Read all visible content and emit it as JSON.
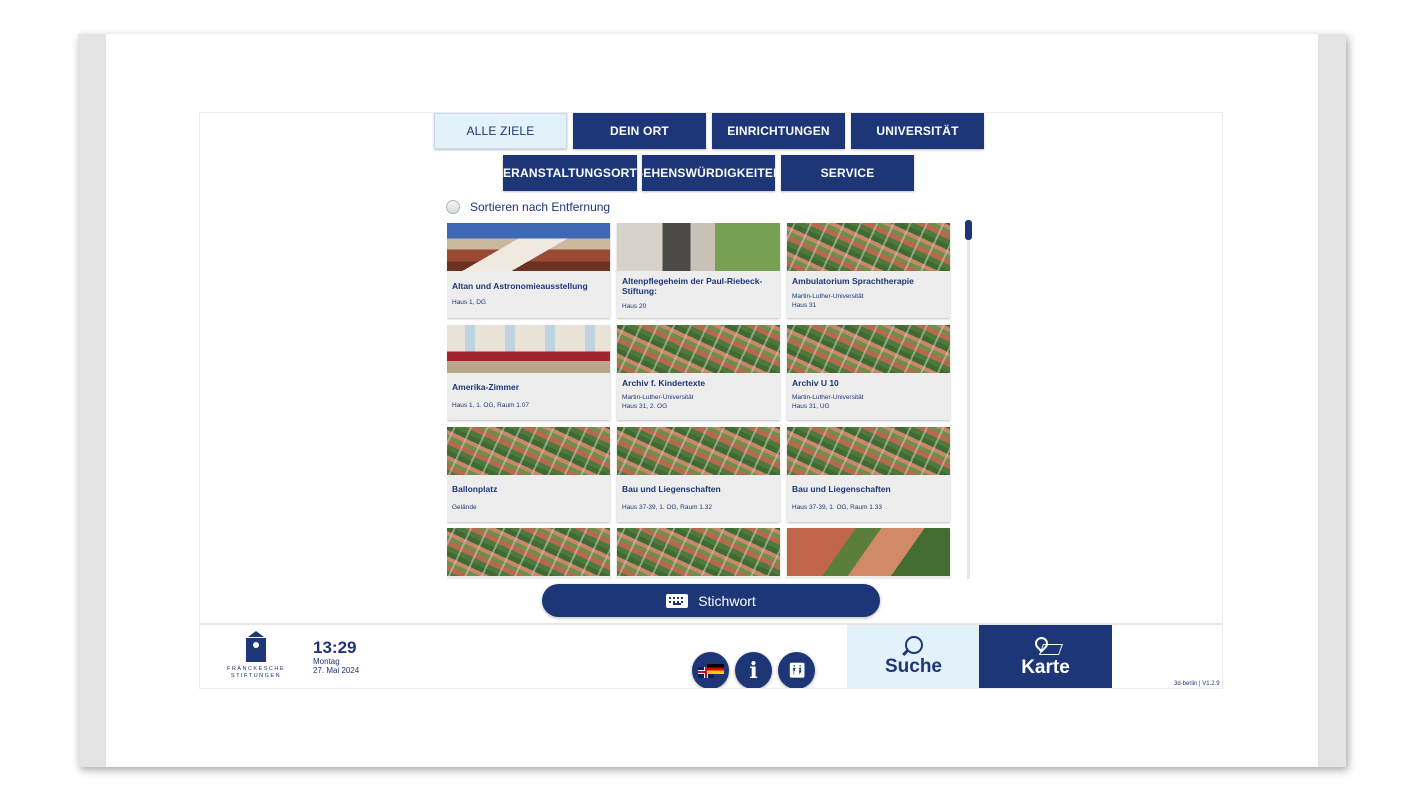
{
  "categories": {
    "alle_ziele": "ALLE ZIELE",
    "dein_ort": "DEIN ORT",
    "einrichtungen": "EINRICHTUNGEN",
    "universitaet": "UNIVERSITÄT",
    "veranstaltungsorte": "VERANSTALTUNGSORTE",
    "sehenswuerdigkeiten": "SEHENSWÜRDIGKEITEN",
    "service": "SERVICE"
  },
  "sort": {
    "label": "Sortieren nach Entfernung"
  },
  "cards": [
    {
      "title": "Altan und Astronomieausstellung",
      "line1": "Haus 1, DG",
      "line2": ""
    },
    {
      "title": "Altenpflegeheim der Paul-Riebeck-Stiftung:",
      "line1": "Haus 20",
      "line2": ""
    },
    {
      "title": "Ambulatorium Sprachtherapie",
      "line1": "Martin-Luther-Universität",
      "line2": "Haus 31"
    },
    {
      "title": "Amerika-Zimmer",
      "line1": "Haus 1, 1. OG, Raum 1.07",
      "line2": ""
    },
    {
      "title": "Archiv f. Kindertexte",
      "line1": "Martin-Luther-Universität",
      "line2": "Haus 31, 2. OG"
    },
    {
      "title": "Archiv U 10",
      "line1": "Martin-Luther-Universität",
      "line2": "Haus 31, UG"
    },
    {
      "title": "Ballonplatz",
      "line1": "Gelände",
      "line2": ""
    },
    {
      "title": "Bau und Liegenschaften",
      "line1": "Haus 37-39, 1. OG, Raum 1.32",
      "line2": ""
    },
    {
      "title": "Bau und Liegenschaften",
      "line1": "Haus 37-39, 1. OG, Raum 1.33",
      "line2": ""
    }
  ],
  "stichwort": {
    "label": "Stichwort"
  },
  "footer": {
    "logo_line1": "FRANCKESCHE",
    "logo_line2": "STIFTUNGEN",
    "time": "13:29",
    "day": "Montag",
    "date": "27. Mai 2024",
    "suche_label": "Suche",
    "karte_label": "Karte",
    "version": "3d-berlin | V1.2.9"
  },
  "icons": {
    "language": "language-flag-icon",
    "info": "info-icon",
    "toilet": "toilet-icon",
    "search": "search-icon",
    "map": "map-icon",
    "keyboard": "keyboard-icon"
  },
  "colors": {
    "primary": "#1c3677",
    "active_bg": "#e3f1fb",
    "card_bg": "#ededed"
  }
}
